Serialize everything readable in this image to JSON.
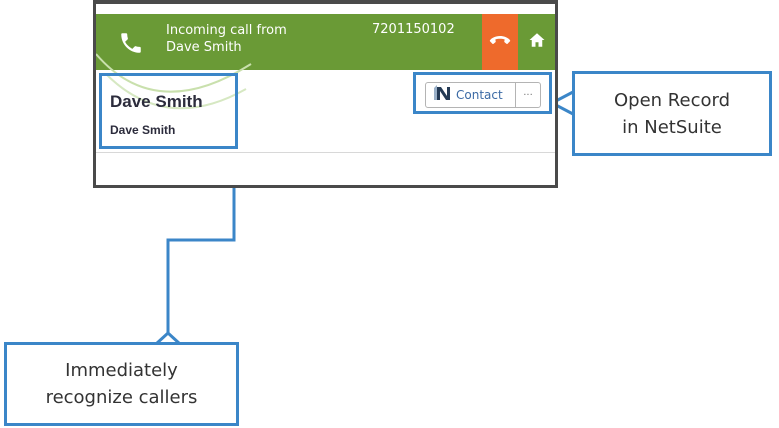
{
  "call_widget": {
    "status_line": "Incoming call from",
    "caller_name": "Dave Smith",
    "phone_number": "7201150102",
    "hangup_color": "#ee6a2c",
    "bar_color": "#6a9a36"
  },
  "contact_panel": {
    "name": "Dave Smith",
    "subtitle": "Dave Smith",
    "record_button_label": "Contact",
    "more_button_label": "···"
  },
  "callouts": {
    "open_record": "Open Record\nin NetSuite",
    "recognize": "Immediately\nrecognize callers",
    "accent": "#3b86c8"
  },
  "icons": [
    "phone-icon",
    "hangup-icon",
    "home-icon",
    "netsuite-logo-icon"
  ]
}
